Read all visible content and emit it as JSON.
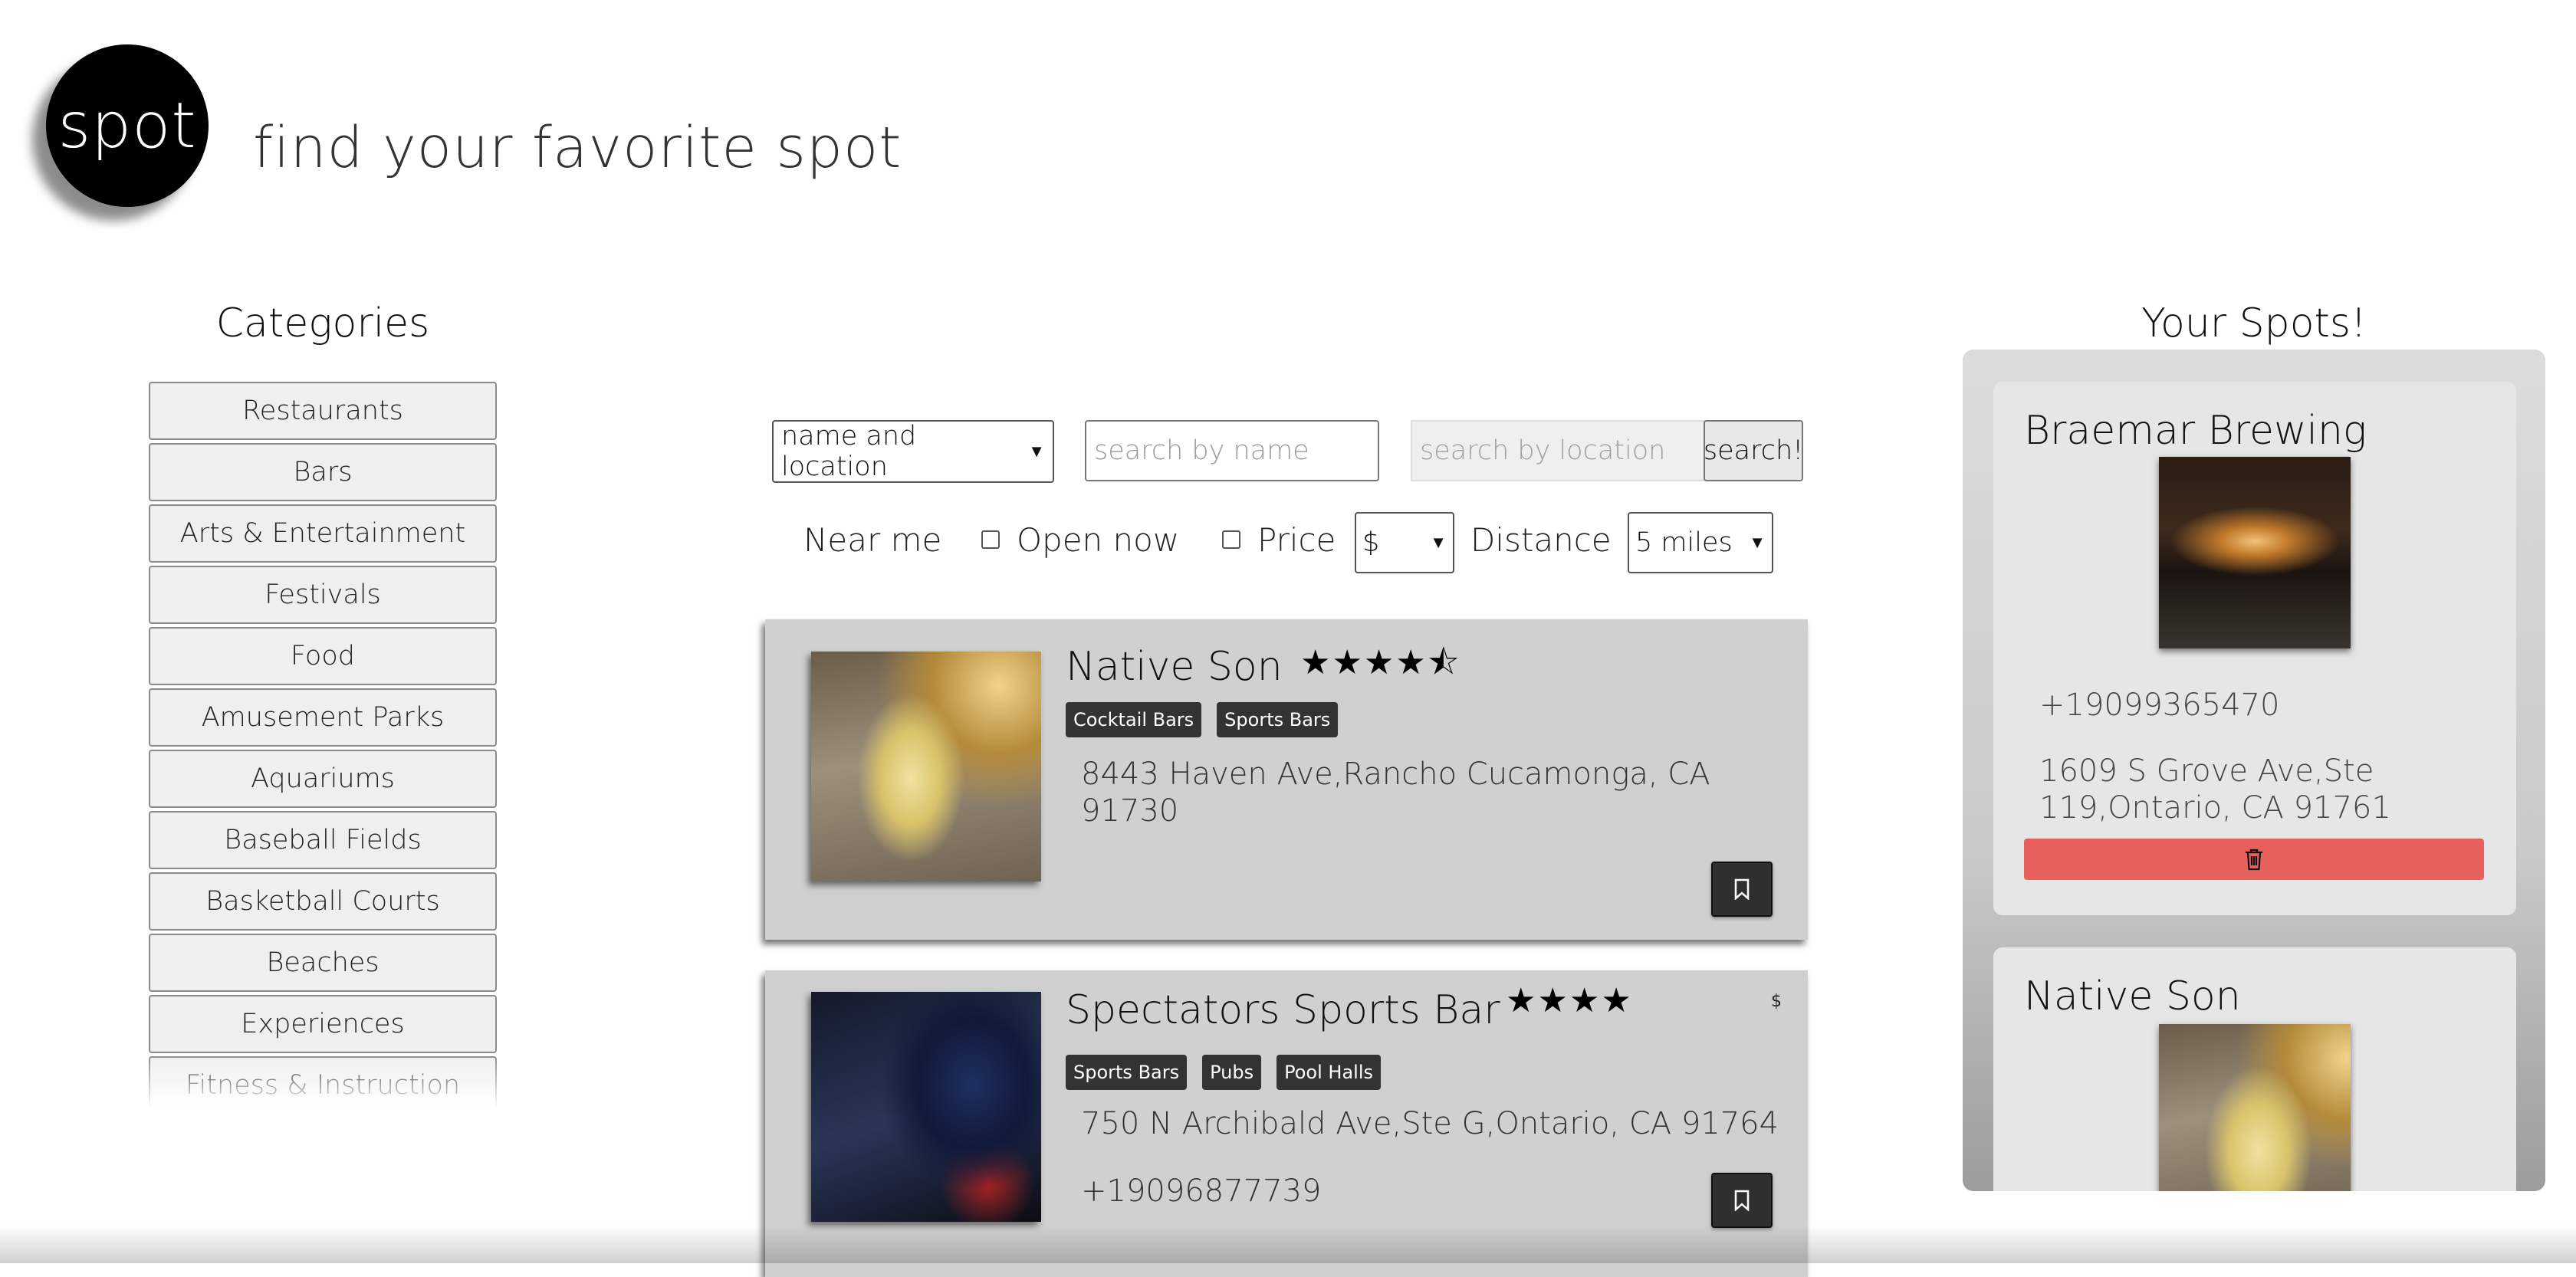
{
  "header": {
    "logo_text": "spot",
    "tagline": "find your favorite spot"
  },
  "categories": {
    "title": "Categories",
    "items": [
      "Restaurants",
      "Bars",
      "Arts & Entertainment",
      "Festivals",
      "Food",
      "Amusement Parks",
      "Aquariums",
      "Baseball Fields",
      "Basketball Courts",
      "Beaches",
      "Experiences",
      "Fitness & Instruction"
    ]
  },
  "search": {
    "type_selected": "name and location",
    "name_placeholder": "search by name",
    "location_placeholder": "search by location",
    "button_label": "search!"
  },
  "filters": {
    "near_me_label": "Near me",
    "open_now_label": "Open now",
    "price_label": "Price",
    "price_selected": "$",
    "distance_label": "Distance",
    "distance_selected": "5 miles"
  },
  "results": [
    {
      "name": "Native Son",
      "rating_stars": "★★★★⯪",
      "rating": 4.5,
      "tags": [
        "Cocktail Bars",
        "Sports Bars"
      ],
      "address": "8443 Haven Ave,Rancho Cucamonga, CA 91730",
      "phone": "",
      "price": ""
    },
    {
      "name": "Spectators Sports Bar",
      "rating_stars": "★★★★",
      "rating": 4,
      "tags": [
        "Sports Bars",
        "Pubs",
        "Pool Halls"
      ],
      "address": "750 N Archibald Ave,Ste G,Ontario, CA 91764",
      "phone": "+19096877739",
      "price": "$"
    }
  ],
  "your_spots": {
    "title": "Your Spots!",
    "items": [
      {
        "name": "Braemar Brewing",
        "phone": "+19099365470",
        "address": "1609 S Grove Ave,Ste 119,Ontario, CA 91761"
      },
      {
        "name": "Native Son"
      }
    ]
  },
  "colors": {
    "delete": "#e8605c",
    "card": "#d0d0d0",
    "tag": "#333333"
  }
}
